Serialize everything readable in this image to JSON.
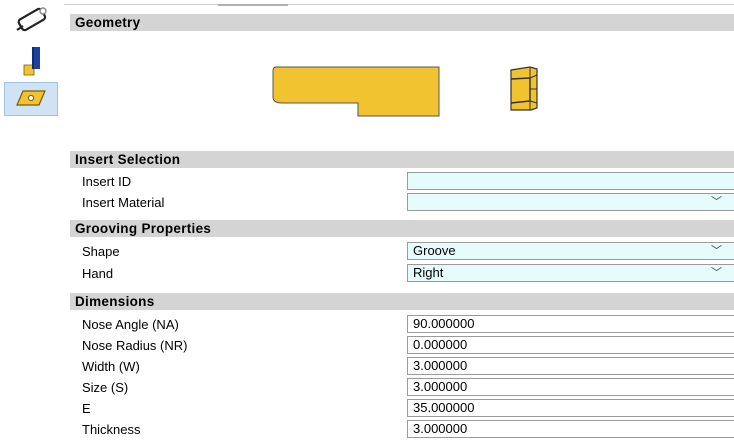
{
  "sections": {
    "geometry": "Geometry",
    "insert_selection": "Insert Selection",
    "grooving_properties": "Grooving Properties",
    "dimensions": "Dimensions"
  },
  "insert_selection": {
    "insert_id_label": "Insert ID",
    "insert_id_value": "",
    "insert_material_label": "Insert Material",
    "insert_material_value": ""
  },
  "grooving": {
    "shape_label": "Shape",
    "shape_value": "Groove",
    "hand_label": "Hand",
    "hand_value": "Right"
  },
  "dimensions": {
    "nose_angle_label": "Nose Angle (NA)",
    "nose_angle_value": "90.000000",
    "nose_radius_label": "Nose Radius (NR)",
    "nose_radius_value": "0.000000",
    "width_label": "Width (W)",
    "width_value": "3.000000",
    "size_label": "Size (S)",
    "size_value": "3.000000",
    "e_label": "E",
    "e_value": "35.000000",
    "thickness_label": "Thickness",
    "thickness_value": "3.000000"
  },
  "toolbar": {
    "items": [
      "tool-holder-icon",
      "holder-bar-icon",
      "insert-icon"
    ],
    "active": "insert-icon"
  },
  "colors": {
    "insert_yellow": "#f2c330",
    "section_header": "#d4d4d4",
    "field_cyan": "#e6fbfb",
    "active_tool": "#cfe3f5"
  }
}
